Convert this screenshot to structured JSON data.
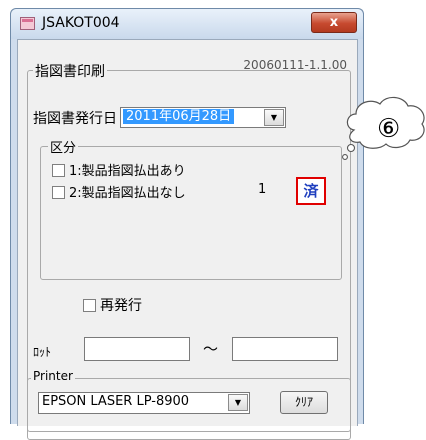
{
  "window": {
    "title": "JSAKOT004",
    "close_label": "x"
  },
  "print_group": {
    "label": "指図書印刷",
    "version": "20060111-1.1.00",
    "issue_date_label": "指図書発行日",
    "issue_date_value": "2011年06月28日"
  },
  "category_group": {
    "label": "区分",
    "items": [
      {
        "label": "1:製品指図払出あり",
        "count": "",
        "status": ""
      },
      {
        "label": "2:製品指図払出なし",
        "count": "1",
        "status": "済"
      }
    ]
  },
  "reissue_label": "再発行",
  "lot": {
    "label": "ﾛｯﾄ",
    "from_value": "",
    "tilde": "～",
    "to_value": ""
  },
  "printer_group": {
    "label": "Printer",
    "selected": "EPSON LASER LP-8900",
    "clear_label": "ｸﾘｱ"
  },
  "callout": {
    "number": "⑥"
  },
  "colors": {
    "badge_border": "#e00000",
    "badge_text": "#1f3fbf",
    "selection": "#3399ff"
  }
}
